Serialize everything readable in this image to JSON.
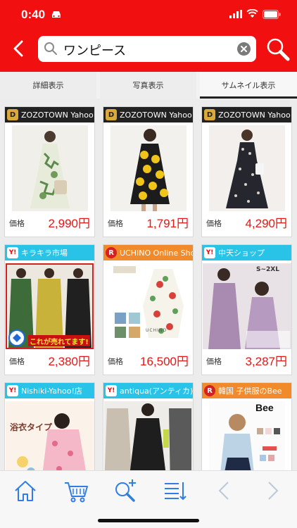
{
  "status_bar": {
    "time": "0:40"
  },
  "search": {
    "query": "ワンピース"
  },
  "tabs": [
    {
      "label": "詳細表示"
    },
    {
      "label": "写真表示"
    },
    {
      "label": "サムネイル表示"
    }
  ],
  "products": [
    {
      "shop": "ZOZOTOWN Yahoo!店",
      "badge": "D",
      "price_label": "価格",
      "price": "2,990円"
    },
    {
      "shop": "ZOZOTOWN Yahoo!店",
      "badge": "D",
      "price_label": "価格",
      "price": "1,791円"
    },
    {
      "shop": "ZOZOTOWN Yahoo!店",
      "badge": "D",
      "price_label": "価格",
      "price": "4,290円"
    },
    {
      "shop": "キラキラ市場",
      "badge": "Y!",
      "price_label": "価格",
      "price": "2,380円",
      "photo_text": "これが売れてます!"
    },
    {
      "shop": "UCHINO Online Shop",
      "badge": "R",
      "price_label": "価格",
      "price": "16,500円",
      "photo_text": "UCHINO"
    },
    {
      "shop": "中天ショップ",
      "badge": "Y!",
      "price_label": "価格",
      "price": "3,287円",
      "photo_text": "S~2XL"
    },
    {
      "shop": "Nishiki-Yahoo!店",
      "badge": "Y!",
      "photo_text": "浴衣タイプ"
    },
    {
      "shop": "antiqua(アンティカ)",
      "badge": "Y!"
    },
    {
      "shop": "韓国 子供服のBee",
      "badge": "R",
      "photo_text": "Bee"
    }
  ],
  "colors": {
    "header_red": "#f20f0f",
    "price_red": "#e41717",
    "toolbar_icon": "#2f7ee8"
  }
}
